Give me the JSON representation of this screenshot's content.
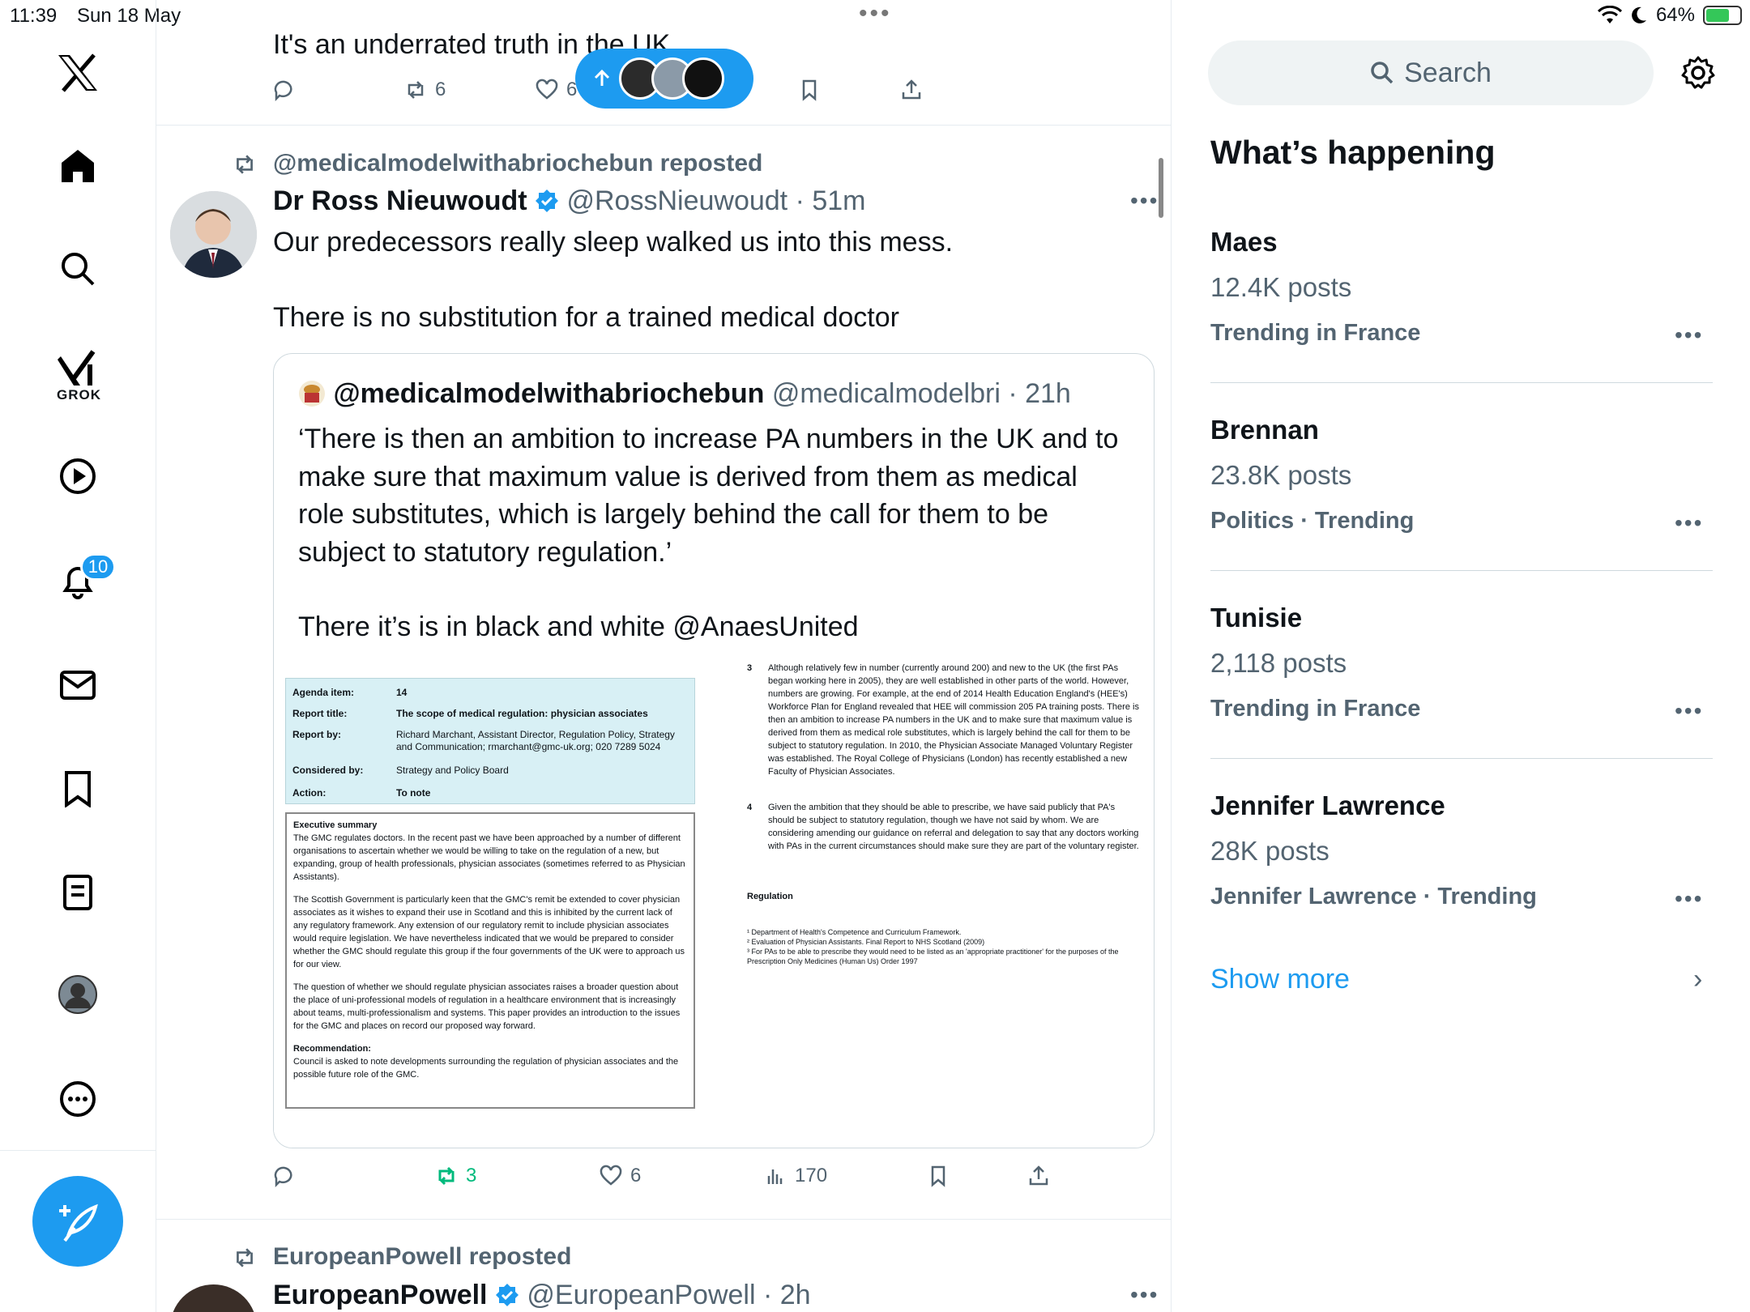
{
  "status": {
    "time": "11:39",
    "date": "Sun 18 May",
    "battery": "64%"
  },
  "sidebar": {
    "grok_label": "GROK",
    "notifications_badge": "10"
  },
  "top_tweet": {
    "text": "It's an underrated truth in the UK",
    "reposts": "6",
    "likes": "6"
  },
  "tweet": {
    "repost_by": "@medicalmodelwithabriochebun reposted",
    "author_name": "Dr Ross Nieuwoudt",
    "author_handle": "@RossNieuwoudt",
    "time": "51m",
    "text_line1": "Our predecessors really sleep walked us into this mess.",
    "text_line2": "There is no substitution for a trained medical doctor",
    "quote": {
      "author_name": "@medicalmodelwithabriochebun",
      "author_handle": "@medicalmodelbri",
      "time": "21h",
      "lines": [
        "‘There is then an ambition to increase PA numbers in the UK and to",
        "make sure that maximum value is derived from them as medical",
        "role substitutes, which is largely behind the call for them to be",
        "subject to statutory regulation.’"
      ],
      "line_last": "There it’s is in black and white @AnaesUnited",
      "document": {
        "agenda_label": "Agenda item:",
        "agenda_value": "14",
        "title_label": "Report title:",
        "title_value": "The scope of medical regulation: physician associates",
        "by_label": "Report by:",
        "by_value": "Richard Marchant, Assistant Director, Regulation Policy, Strategy and Communication; rmarchant@gmc-uk.org; 020 7289 5024",
        "considered_label": "Considered by:",
        "considered_value": "Strategy and Policy Board",
        "action_label": "Action:",
        "action_value": "To note",
        "summary_heading": "Executive summary",
        "summary_p1": "The GMC regulates doctors. In the recent past we have been approached by a number of different organisations to ascertain whether we would be willing to take on the regulation of a new, but expanding, group of health professionals, physician associates (sometimes referred to as Physician Assistants).",
        "summary_p2": "The Scottish Government is particularly keen that the GMC's remit be extended to cover physician associates as it wishes to expand their use in Scotland and this is inhibited by the current lack of any regulatory framework. Any extension of our regulatory remit to include physician associates would require legislation. We have nevertheless indicated that we would be prepared to consider whether the GMC should regulate this group if the four governments of the UK were to approach us for our view.",
        "summary_p3": "The question of whether we should regulate physician associates raises a broader question about the place of uni-professional models of regulation in a healthcare environment that is increasingly about teams, multi-professionalism and systems. This paper provides an introduction to the issues for the GMC and places on record our proposed way forward.",
        "recommendation_heading": "Recommendation:",
        "recommendation": "Council is asked to note developments surrounding the regulation of physician associates and the possible future role of the GMC.",
        "para3_num": "3",
        "para3": "Although relatively few in number (currently around 200) and new to the UK (the first PAs began working here in 2005), they are well established in other parts of the world. However, numbers are growing. For example, at the end of 2014 Health Education England's (HEE's) Workforce Plan for England revealed that HEE will commission 205 PA training posts. There is then an ambition to increase PA numbers in the UK and to make sure that maximum value is derived from them as medical role substitutes, which is largely behind the call for them to be subject to statutory regulation. In 2010, the Physician Associate Managed Voluntary Register was established. The Royal College of Physicians (London) has recently established a new Faculty of Physician Associates.",
        "para4_num": "4",
        "para4": "Given the ambition that they should be able to prescribe, we have said publicly that PA's should be subject to statutory regulation, though we have not said by whom. We are considering amending our guidance on referral and delegation to say that any doctors working with PAs in the current circumstances should make sure they are part of the voluntary register.",
        "regulation_heading": "Regulation",
        "footnote1": "¹ Department of Health's Competence and Curriculum Framework.",
        "footnote2": "² Evaluation of Physician Assistants. Final Report to NHS Scotland (2009)",
        "footnote3": "³ For PAs to be able to prescribe they would need to be listed as an 'appropriate practitioner' for the purposes of the Prescription Only Medicines (Human Us) Order 1997"
      }
    },
    "reposts": "3",
    "likes": "6",
    "views": "170"
  },
  "next_tweet": {
    "repost_by": "EuropeanPowell reposted",
    "author_name": "EuropeanPowell",
    "author_handle": "@EuropeanPowell",
    "time": "2h"
  },
  "right": {
    "search_placeholder": "Search",
    "title": "What’s happening",
    "trends": [
      {
        "name": "Maes",
        "count": "12.4K posts",
        "category": "Trending in France"
      },
      {
        "name": "Brennan",
        "count": "23.8K posts",
        "category": "Politics · Trending"
      },
      {
        "name": "Tunisie",
        "count": "2,118 posts",
        "category": "Trending in France"
      },
      {
        "name": "Jennifer Lawrence",
        "count": "28K posts",
        "category": "Jennifer Lawrence · Trending"
      }
    ],
    "show_more": "Show more"
  },
  "colors": {
    "accent": "#1d9bf0",
    "repost_green": "#00ba7c",
    "muted": "#536471"
  }
}
